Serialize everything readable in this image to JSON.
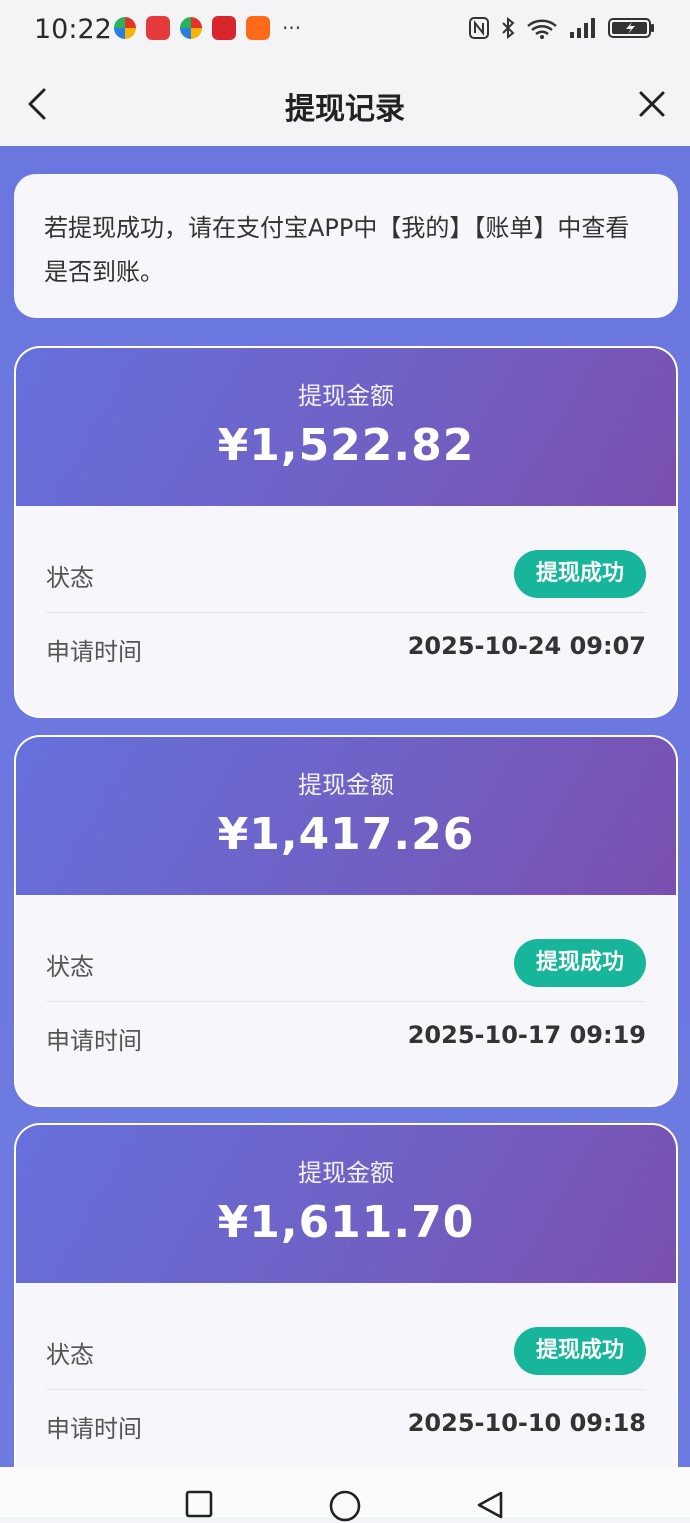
{
  "status_bar": {
    "time": "10:22",
    "app_icons": [
      "pinwheel-icon",
      "red-app-icon",
      "pinwheel-icon",
      "vmall-icon",
      "taobao-icon"
    ],
    "more": "···",
    "right_icons": [
      "nfc-icon",
      "bluetooth-icon",
      "wifi-6-icon",
      "signal-icon",
      "battery-charging-icon"
    ]
  },
  "nav": {
    "title": "提现记录"
  },
  "notice": {
    "text": "若提现成功，请在支付宝APP中【我的】【账单】中查看是否到账。"
  },
  "records": [
    {
      "amount_label": "提现金额",
      "amount": "¥1,522.82",
      "status_label": "状态",
      "status": "提现成功",
      "time_label": "申请时间",
      "time": "2025-10-24 09:07"
    },
    {
      "amount_label": "提现金额",
      "amount": "¥1,417.26",
      "status_label": "状态",
      "status": "提现成功",
      "time_label": "申请时间",
      "time": "2025-10-17 09:19"
    },
    {
      "amount_label": "提现金额",
      "amount": "¥1,611.70",
      "status_label": "状态",
      "status": "提现成功",
      "time_label": "申请时间",
      "time": "2025-10-10 09:18"
    }
  ],
  "colors": {
    "background": "#6a77df",
    "header_gradient_start": "#6670dc",
    "header_gradient_end": "#7a4fae",
    "success_badge": "#17b59a"
  }
}
